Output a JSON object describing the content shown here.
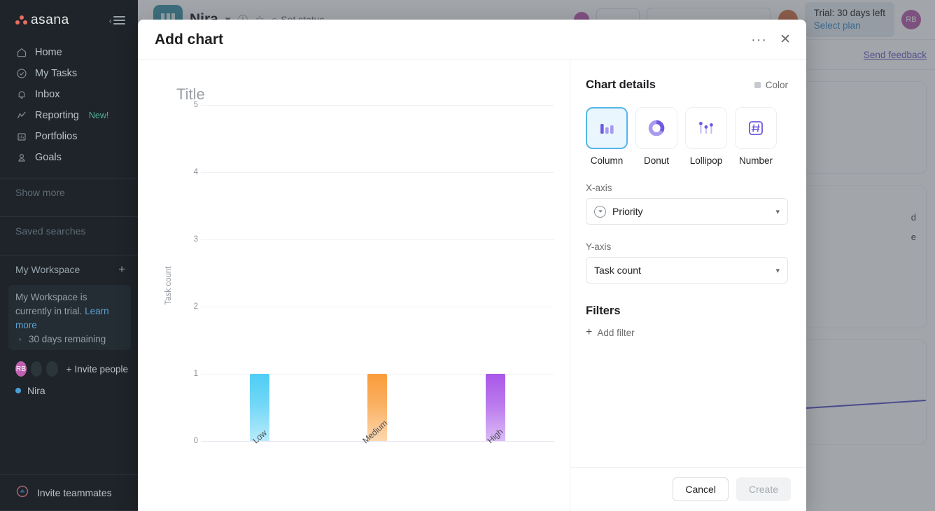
{
  "sidebar": {
    "brand": "asana",
    "collapse_icon": "collapse-sidebar-icon",
    "nav": [
      {
        "label": "Home",
        "icon": "home-icon"
      },
      {
        "label": "My Tasks",
        "icon": "check-circle-icon"
      },
      {
        "label": "Inbox",
        "icon": "bell-icon"
      },
      {
        "label": "Reporting",
        "icon": "chart-line-icon",
        "badge": "New!"
      },
      {
        "label": "Portfolios",
        "icon": "portfolio-icon"
      },
      {
        "label": "Goals",
        "icon": "goal-icon"
      }
    ],
    "show_more": "Show more",
    "saved_searches": "Saved searches",
    "workspace": "My Workspace",
    "trial_text": "My Workspace is currently in",
    "trial_text2": "trial.",
    "learn_more": "Learn more",
    "days_remaining": "30 days remaining",
    "avatar_initials": "RB",
    "invite_people": "Invite people",
    "project": "Nira",
    "invite_teammates": "Invite teammates"
  },
  "topbar": {
    "project_name": "Nira",
    "set_status": "Set status",
    "trial_title": "Trial: 30 days left",
    "select_plan": "Select plan",
    "avatar_initials": "RB",
    "send_feedback": "Send feedback",
    "card_text_1": "d",
    "card_text_2": "e"
  },
  "modal": {
    "title": "Add chart",
    "more_label": "···",
    "close_label": "✕",
    "details_title": "Chart details",
    "color_label": "Color",
    "chart_types": [
      {
        "label": "Column",
        "icon": "column-chart-icon",
        "selected": true
      },
      {
        "label": "Donut",
        "icon": "donut-chart-icon",
        "selected": false
      },
      {
        "label": "Lollipop",
        "icon": "lollipop-chart-icon",
        "selected": false
      },
      {
        "label": "Number",
        "icon": "number-chart-icon",
        "selected": false
      }
    ],
    "x_axis_label": "X-axis",
    "x_axis_value": "Priority",
    "y_axis_label": "Y-axis",
    "y_axis_value": "Task count",
    "filters_title": "Filters",
    "add_filter": "Add filter",
    "cancel": "Cancel",
    "create": "Create"
  },
  "chart_data": {
    "type": "bar",
    "title": "Title",
    "categories": [
      "Low",
      "Medium",
      "High"
    ],
    "values": [
      1,
      1,
      1
    ],
    "colors": [
      "#4ecdf5",
      "#f99c3a",
      "#a857e8"
    ],
    "xlabel": "",
    "ylabel": "Task count",
    "yticks": [
      "0",
      "1",
      "2",
      "3",
      "4",
      "5"
    ],
    "ylim": [
      0,
      5
    ],
    "grid": true,
    "legend": false
  }
}
